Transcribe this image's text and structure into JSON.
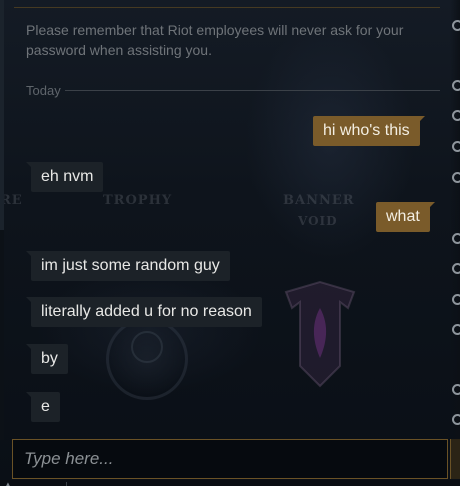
{
  "notice": "Please remember that Riot employees will never ask for your password when assisting you.",
  "date_divider": "Today",
  "background_art": {
    "label_re": "RE",
    "label_trophy": "TROPHY",
    "label_banner": "BANNER",
    "label_void": "VOID"
  },
  "messages": [
    {
      "direction": "outgoing",
      "text": "hi who's this"
    },
    {
      "direction": "incoming",
      "text": "eh nvm"
    },
    {
      "direction": "outgoing",
      "text": "what"
    },
    {
      "direction": "incoming",
      "text": "im just some random guy"
    },
    {
      "direction": "incoming",
      "text": "literally added u for no reason"
    },
    {
      "direction": "incoming",
      "text": "by"
    },
    {
      "direction": "incoming",
      "text": "e"
    }
  ],
  "input": {
    "placeholder": "Type here...",
    "value": ""
  },
  "colors": {
    "outgoing_bubble": "#7a5b2a",
    "incoming_bubble": "#1c2228",
    "input_border": "#6a5226"
  }
}
